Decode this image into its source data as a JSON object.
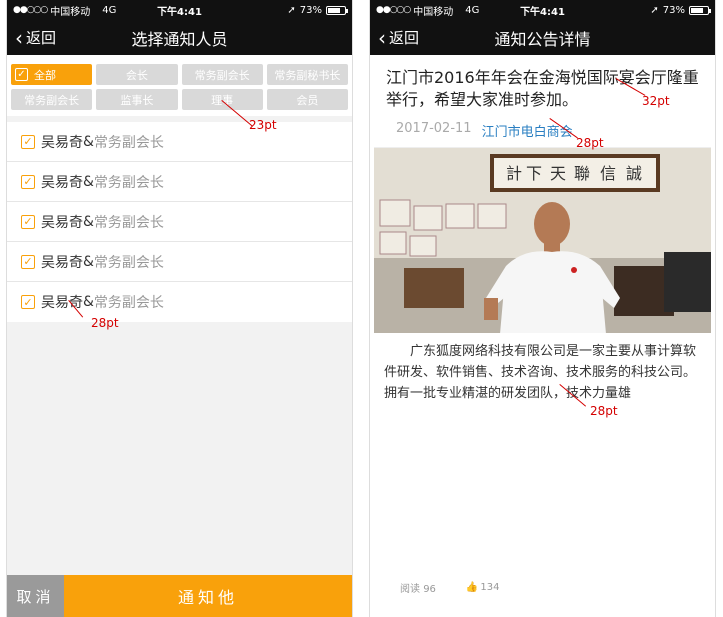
{
  "status_bar": {
    "signal": "●●○○○",
    "carrier": "中国移动",
    "network": "4G",
    "time": "下午4:41",
    "battery": "73%",
    "battery_level": 0.73
  },
  "left_screen": {
    "back_label": "返回",
    "title": "选择通知人员",
    "filters": [
      {
        "label": "全部",
        "active": true
      },
      {
        "label": "会长",
        "active": false
      },
      {
        "label": "常务副会长",
        "active": false
      },
      {
        "label": "常务副秘书长",
        "active": false
      },
      {
        "label": "常务副会长",
        "active": false
      },
      {
        "label": "监事长",
        "active": false
      },
      {
        "label": "理事",
        "active": false
      },
      {
        "label": "会员",
        "active": false
      }
    ],
    "members": [
      {
        "name": "吴易奇",
        "amp": "&",
        "role": "常务副会长",
        "checked": true
      },
      {
        "name": "吴易奇",
        "amp": "&",
        "role": "常务副会长",
        "checked": true
      },
      {
        "name": "吴易奇",
        "amp": "&",
        "role": "常务副会长",
        "checked": true
      },
      {
        "name": "吴易奇",
        "amp": "&",
        "role": "常务副会长",
        "checked": true
      },
      {
        "name": "吴易奇",
        "amp": "&",
        "role": "常务副会长",
        "checked": true
      }
    ],
    "cancel_label": "取消",
    "notify_label": "通知他",
    "annotations": {
      "filter_size": "23pt",
      "member_size": "28pt"
    }
  },
  "right_screen": {
    "back_label": "返回",
    "title": "通知公告详情",
    "article_title": "江门市2016年年会在金海悦国际宴会厅隆重举行，希望大家准时参加。",
    "date": "2017-02-11",
    "source": "江门市电白商会",
    "body": "广东狐度网络科技有限公司是一家主要从事计算软件研发、软件销售、技术咨询、技术服务的科技公司。拥有一批专业精湛的研发团队，技术力量雄",
    "read_label": "阅读",
    "read_count": "96",
    "like_count": "134",
    "annotations": {
      "title_size": "32pt",
      "source_size": "28pt",
      "body_size": "28pt"
    }
  },
  "colors": {
    "accent": "#f9a10b",
    "link": "#2a7fc2",
    "annotation": "#d40000",
    "nav_bg": "#111111"
  }
}
